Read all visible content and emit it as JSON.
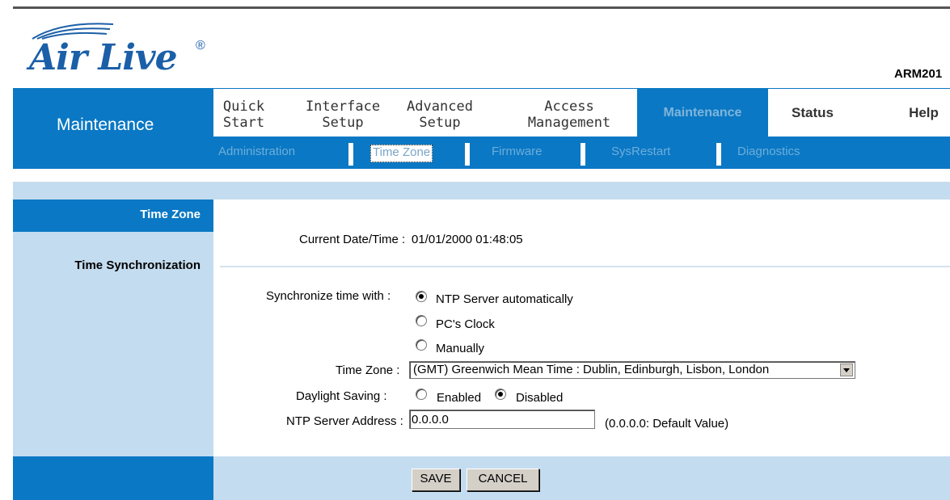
{
  "brand": {
    "logo_text": "Air Live",
    "registered": "®",
    "model": "ARM201"
  },
  "header": {
    "section_title": "Maintenance"
  },
  "menu": [
    {
      "line1": "Quick",
      "line2": "Start"
    },
    {
      "line1": "Interface",
      "line2": "Setup"
    },
    {
      "line1": "Advanced",
      "line2": "Setup"
    },
    {
      "line1": "Access",
      "line2": "Management"
    },
    {
      "line1": "Maintenance",
      "line2": ""
    },
    {
      "line1": "Status",
      "line2": ""
    },
    {
      "line1": "Help",
      "line2": ""
    }
  ],
  "submenu": [
    "Administration",
    "Time Zone",
    "Firmware",
    "SysRestart",
    "Diagnostics"
  ],
  "sidebar": {
    "time_zone": "Time Zone",
    "time_sync": "Time Synchronization"
  },
  "form": {
    "current_label": "Current Date/Time :",
    "current_value": "01/01/2000 01:48:05",
    "sync_label": "Synchronize time with :",
    "sync_options": [
      "NTP Server automatically",
      "PC's Clock",
      "Manually"
    ],
    "sync_selected": "NTP Server automatically",
    "tz_label": "Time Zone :",
    "tz_value": "(GMT) Greenwich Mean Time : Dublin, Edinburgh, Lisbon, London",
    "dst_label": "Daylight Saving :",
    "dst_options": [
      "Enabled",
      "Disabled"
    ],
    "dst_selected": "Disabled",
    "ntp_label": "NTP Server Address :",
    "ntp_value": "0.0.0.0",
    "ntp_hint": "(0.0.0.0: Default Value)"
  },
  "buttons": {
    "save": "SAVE",
    "cancel": "CANCEL"
  }
}
